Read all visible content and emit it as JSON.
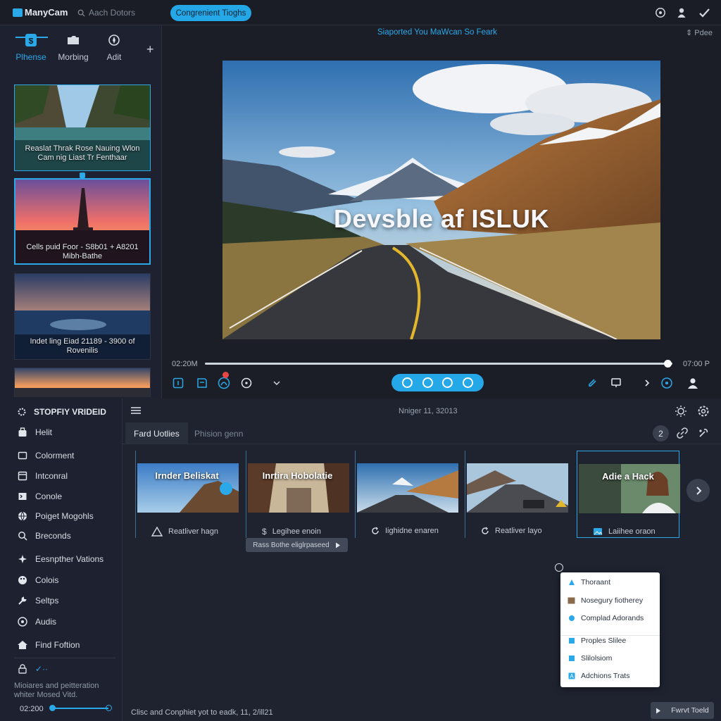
{
  "app": {
    "name": "ManyCam",
    "search_placeholder": "Aach Dotors",
    "pill_label": "Congrenient Tioghs"
  },
  "left_tabs": [
    {
      "label": "Plhense",
      "icon": "dollar-square-icon"
    },
    {
      "label": "Morbing",
      "icon": "folder-icon"
    },
    {
      "label": "Adit",
      "icon": "compass-icon"
    }
  ],
  "thumbnails": [
    {
      "caption": "Reaslat Thrak Rose Nauing Wlon Cam nig Liast Tr Fenthaar"
    },
    {
      "caption": "Cells puid Foor - S8b01 + A8201 Mibh-Bathe"
    },
    {
      "caption": "Indet ling Eiad 21189 - 3900 of Rovenilis"
    },
    {
      "caption": ""
    }
  ],
  "preview": {
    "title": "Siaported You MaWcan So Feark",
    "right_label": "Pdee",
    "overlay_title": "Devsble af ISLUK",
    "time_start": "02:20M",
    "time_end": "07:00 P",
    "progress": 0.99
  },
  "sidebar": {
    "title": "STOPFIY VRIDEID",
    "items": [
      {
        "label": "Helit",
        "icon": "bag-icon"
      },
      {
        "label": "Colorment",
        "icon": "frame-icon"
      },
      {
        "label": "Intconral",
        "icon": "window-icon"
      },
      {
        "label": "Conole",
        "icon": "console-icon"
      },
      {
        "label": "Poiget Mogohls",
        "icon": "globe-icon"
      },
      {
        "label": "Breconds",
        "icon": "search-icon"
      },
      {
        "label": "Eesnpther Vations",
        "icon": "sparkle-icon"
      },
      {
        "label": "Colois",
        "icon": "palette-icon"
      },
      {
        "label": "Seltps",
        "icon": "wrench-icon"
      },
      {
        "label": "Audis",
        "icon": "audio-icon"
      },
      {
        "label": "Find Foftion",
        "icon": "home-icon"
      }
    ],
    "lock_label": "✓··",
    "note": "Mioiares and peitteration whiter Mosed Vitd.",
    "volume_label": "02:200"
  },
  "lower": {
    "date": "Nniger 11, 32013",
    "tabs": [
      "Fard Uotlies",
      "Phision genn"
    ],
    "count": "2",
    "clips": [
      {
        "overlay": "Irnder Beliskat",
        "label": "Reatliver hagn",
        "icon": "warning-icon"
      },
      {
        "overlay": "Inrtira Hobolatie",
        "label": "Legihee enoin",
        "icon": "dollar-icon"
      },
      {
        "overlay": "",
        "label": "Iighidne enaren",
        "icon": "refresh-icon"
      },
      {
        "overlay": "",
        "label": "Reatliver layo",
        "icon": "refresh-icon"
      },
      {
        "overlay": "Adie a Hack",
        "label": "Laiihee oraon",
        "icon": "image-icon"
      }
    ],
    "tooltip": "Rass Bothe eliglrpaseed",
    "menu": [
      {
        "label": "Thoraant",
        "icon": "triangle-icon"
      },
      {
        "label": "Nosegury fiotherey",
        "icon": "image-icon"
      },
      {
        "label": "Complad Adorands",
        "icon": "circle-icon"
      },
      {
        "label": "Proples Slilee",
        "icon": "square-icon"
      },
      {
        "label": "Slilolsiom",
        "icon": "square-icon"
      },
      {
        "label": "Adchions Trats",
        "icon": "text-icon"
      }
    ],
    "footer_text": "Clisc and Conphiet yot to eadk, 11, 2/ill21",
    "export_label": "Fwrvt Toeld"
  },
  "colors": {
    "accent": "#2aa8e8",
    "background": "#1e222c",
    "panel": "#1e2230"
  }
}
